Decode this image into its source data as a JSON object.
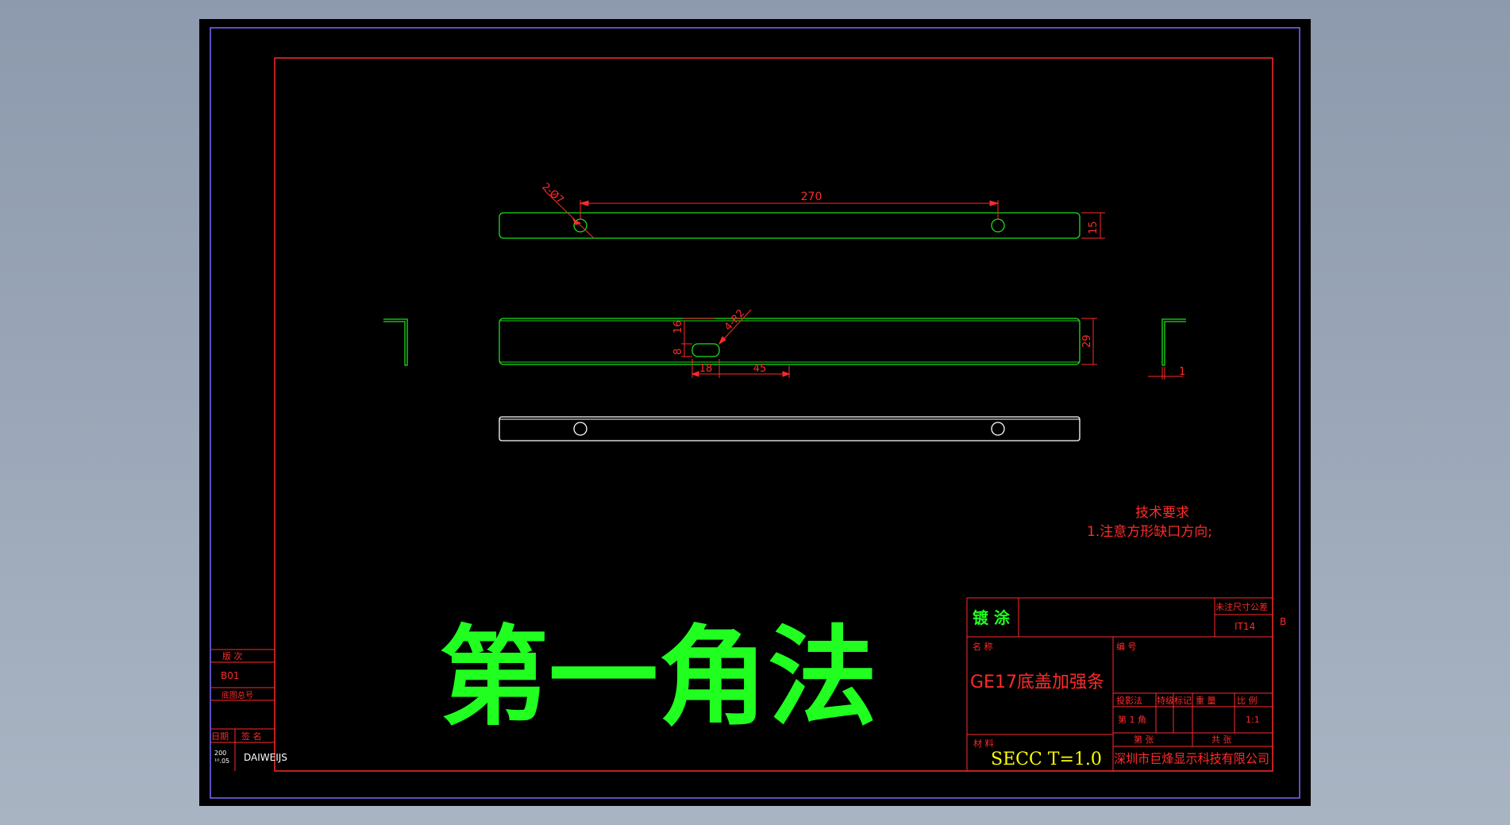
{
  "dimensions": {
    "hole_callout": "2-Ø7",
    "hole_spacing": "270",
    "height_top": "15",
    "notch_callout": "4-R2",
    "notch_h1": "16",
    "notch_h2": "8",
    "height_front": "29",
    "notch_w": "18",
    "notch_offset": "45",
    "thickness": "1"
  },
  "tech_requirements": {
    "title": "技术要求",
    "item1": "1.注意方形缺口方向;"
  },
  "projection_label": "第一角法",
  "left_panel": {
    "version_label": "版  次",
    "version_value": "B01",
    "drawing_no_label": "底图总号",
    "date_label": "日期",
    "sign_label": "签 名",
    "date_value_1": "200",
    "date_value_2": "¹⁰.05",
    "signer": "DAIWEIJS"
  },
  "title_block": {
    "coating_label": "镀 涂",
    "tolerance_label": "未注尺寸公差",
    "tolerance_value": "IT14",
    "revision_mark": "B",
    "name_label": "名  称",
    "part_name": "GE17底盖加强条",
    "number_label": "编   号",
    "projection_label": "投影法",
    "mark_label": "特级标记",
    "weight_label": "重  量",
    "scale_label": "比  例",
    "projection_value": "第 1 角",
    "scale_value": "1:1",
    "material_label": "材  料",
    "material_value": "SECC  T=1.0",
    "sheet_label": "第    张",
    "total_label": "共    张",
    "company": "深圳市巨烽显示科技有限公司"
  },
  "colors": {
    "border_red": "#ff2a2a",
    "line_green": "#19e019",
    "line_white": "#ffffff",
    "frame_purple": "#7a6cff",
    "big_text_green": "#21ff21"
  }
}
